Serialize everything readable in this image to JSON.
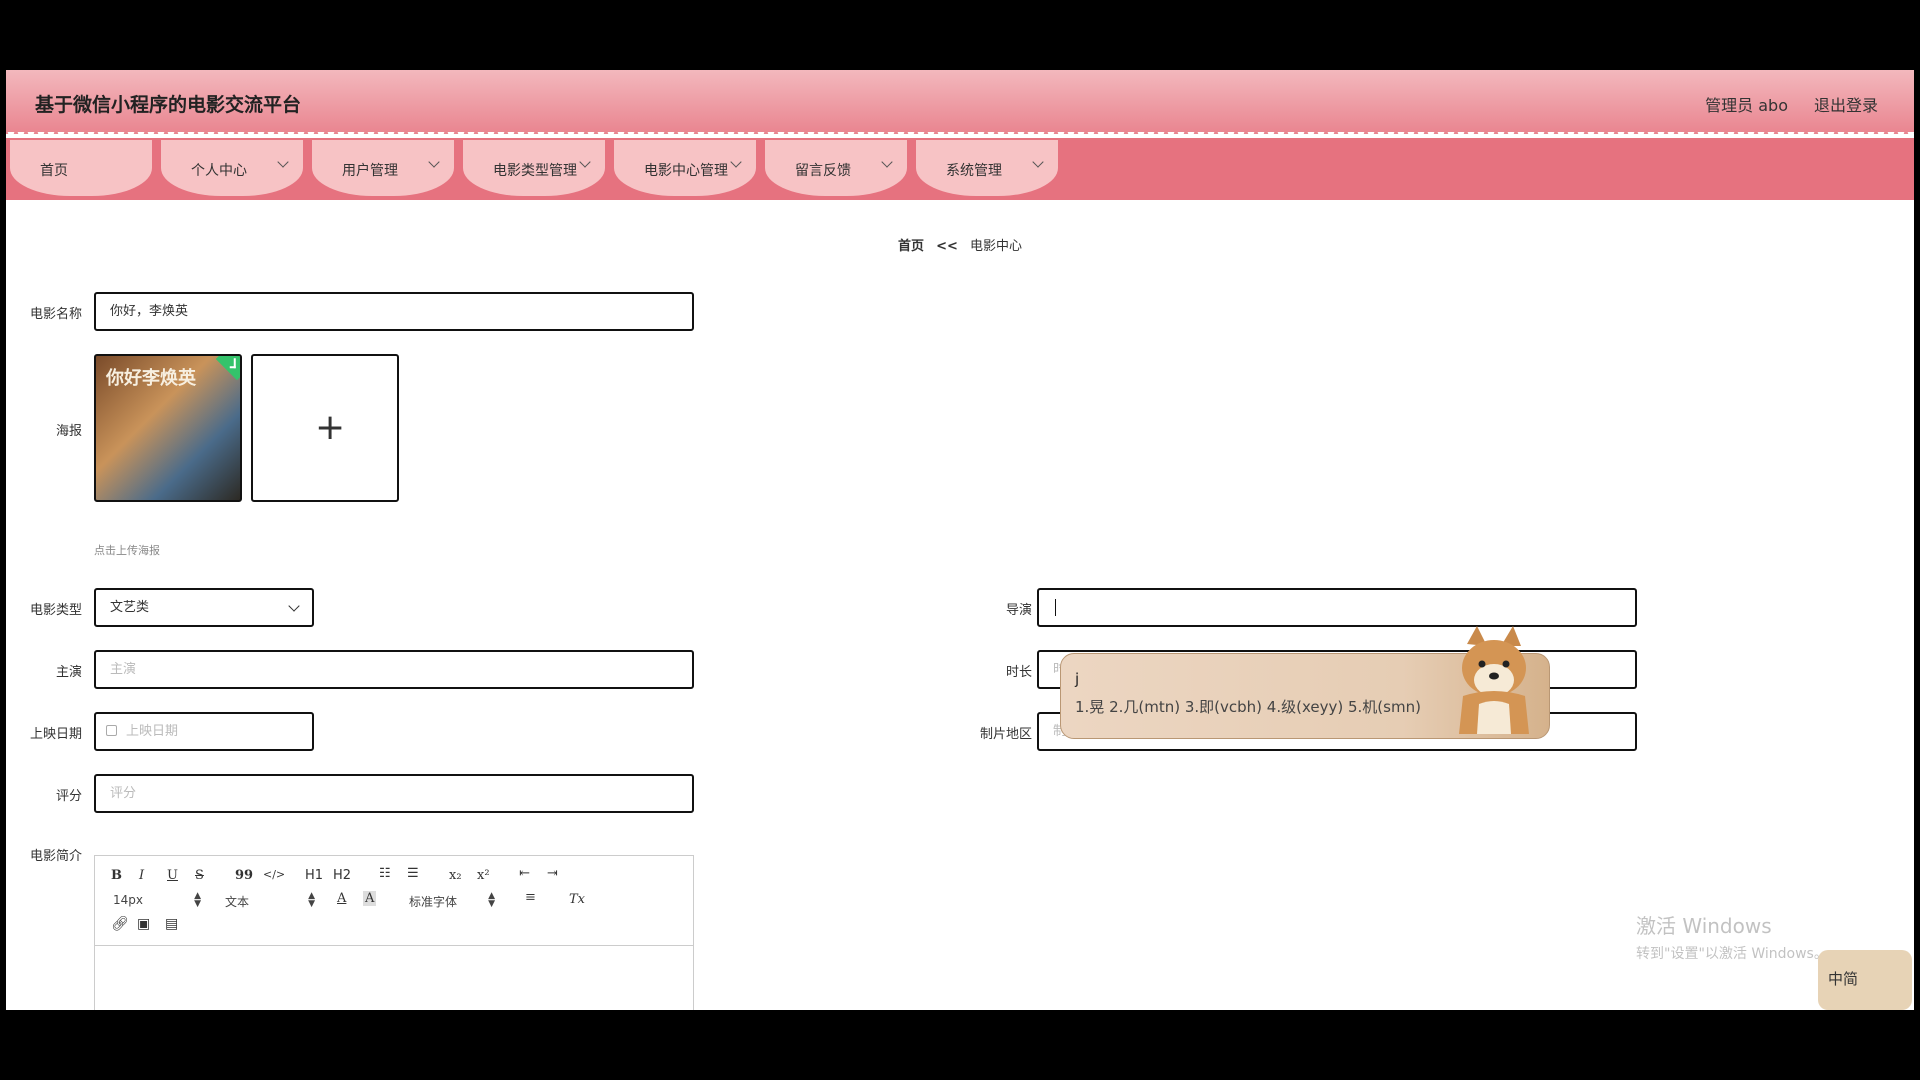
{
  "header": {
    "title": "基于微信小程序的电影交流平台",
    "user": "管理员 abo",
    "logout": "退出登录"
  },
  "nav": [
    {
      "label": "首页"
    },
    {
      "label": "个人中心"
    },
    {
      "label": "用户管理"
    },
    {
      "label": "电影类型管理"
    },
    {
      "label": "电影中心管理"
    },
    {
      "label": "留言反馈"
    },
    {
      "label": "系统管理"
    }
  ],
  "breadcrumb": {
    "home": "首页",
    "sep": "<<",
    "current": "电影中心"
  },
  "form": {
    "name": {
      "label": "电影名称",
      "value": "你好，李焕英"
    },
    "poster": {
      "label": "海报",
      "hint": "点击上传海报",
      "poster_title": "你好李焕英"
    },
    "type": {
      "label": "电影类型",
      "value": "文艺类"
    },
    "director": {
      "label": "导演",
      "value": ""
    },
    "actor": {
      "label": "主演",
      "placeholder": "主演"
    },
    "duration": {
      "label": "时长",
      "placeholder": "时长"
    },
    "date": {
      "label": "上映日期",
      "placeholder": "上映日期"
    },
    "region": {
      "label": "制片地区",
      "placeholder": "制片地区"
    },
    "score": {
      "label": "评分",
      "placeholder": "评分"
    },
    "intro": {
      "label": "电影简介"
    }
  },
  "editor": {
    "bold": "B",
    "italic": "I",
    "underline": "U",
    "strike": "S",
    "quote": "99",
    "code": "</>",
    "h1": "H1",
    "h2": "H2",
    "sub": "x₂",
    "sup": "x²",
    "size": "14px",
    "format": "文本",
    "font": "标准字体",
    "clear": "Tx"
  },
  "ime": {
    "composition": "j",
    "candidates": "1.晃  2.几(mtn)  3.即(vcbh)  4.级(xeyy)  5.机(smn)"
  },
  "watermark": {
    "line1": "激活 Windows",
    "line2": "转到\"设置\"以激活 Windows。"
  },
  "tray": {
    "label": "中简"
  }
}
